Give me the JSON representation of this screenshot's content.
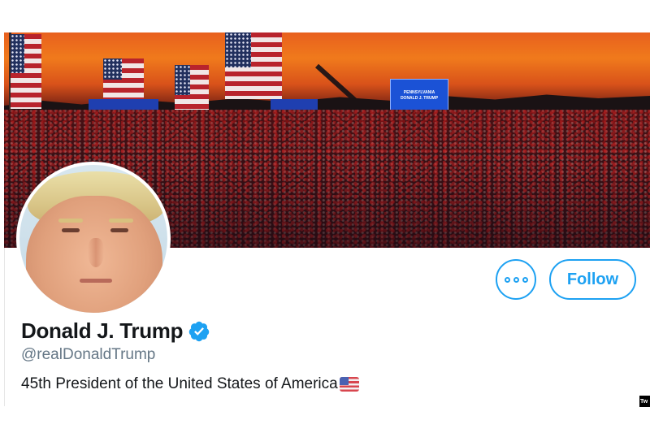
{
  "profile": {
    "display_name": "Donald J. Trump",
    "handle": "@realDonaldTrump",
    "bio": "45th President of the United States of America",
    "verified": true
  },
  "actions": {
    "more_icon": "more-dots-icon",
    "follow_label": "Follow"
  },
  "banner": {
    "screen_line1": "PENNSYLVANIA",
    "screen_line2": "DONALD J. TRUMP"
  },
  "watermark": {
    "label": "Tw"
  },
  "colors": {
    "accent": "#1da1f2",
    "name": "#14171a",
    "handle": "#657786"
  }
}
